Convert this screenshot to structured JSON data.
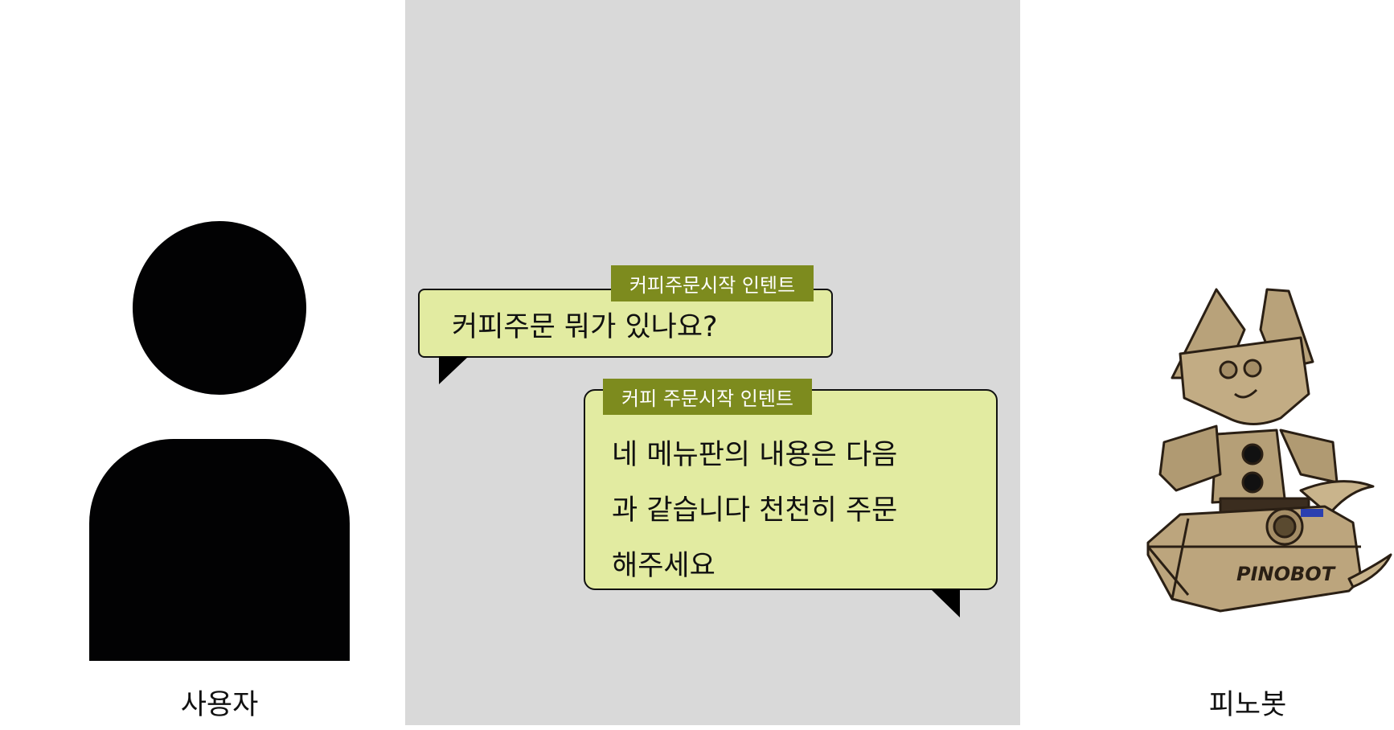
{
  "user": {
    "label": "사용자",
    "icon": "person-silhouette-icon"
  },
  "robot": {
    "label": "피노봇",
    "logo_text": "PINOBOT"
  },
  "bubbles": [
    {
      "intent": "커피주문시작 인텐트",
      "text": "커피주문 뭐가 있나요?"
    },
    {
      "intent": "커피 주문시작 인텐트",
      "lines": [
        "네 메뉴판의 내용은 다음",
        "과 같습니다 천천히 주문",
        "해주세요"
      ]
    }
  ],
  "colors": {
    "bubble_fill": "#e2eba1",
    "tag_fill": "#7d8b1e",
    "panel": "#d9d9d9"
  }
}
